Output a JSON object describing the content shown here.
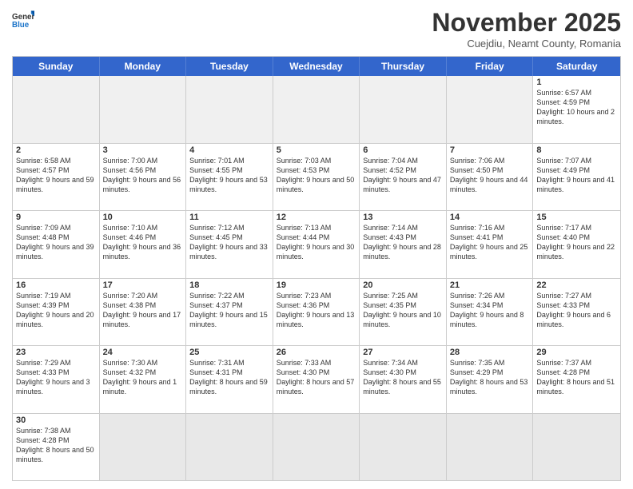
{
  "logo": {
    "line1": "General",
    "line2": "Blue"
  },
  "title": "November 2025",
  "subtitle": "Cuejdiu, Neamt County, Romania",
  "header_days": [
    "Sunday",
    "Monday",
    "Tuesday",
    "Wednesday",
    "Thursday",
    "Friday",
    "Saturday"
  ],
  "weeks": [
    [
      {
        "day": "",
        "info": "",
        "empty": true
      },
      {
        "day": "",
        "info": "",
        "empty": true
      },
      {
        "day": "",
        "info": "",
        "empty": true
      },
      {
        "day": "",
        "info": "",
        "empty": true
      },
      {
        "day": "",
        "info": "",
        "empty": true
      },
      {
        "day": "",
        "info": "",
        "empty": true
      },
      {
        "day": "1",
        "info": "Sunrise: 6:57 AM\nSunset: 4:59 PM\nDaylight: 10 hours and 2 minutes."
      }
    ],
    [
      {
        "day": "2",
        "info": "Sunrise: 6:58 AM\nSunset: 4:57 PM\nDaylight: 9 hours and 59 minutes."
      },
      {
        "day": "3",
        "info": "Sunrise: 7:00 AM\nSunset: 4:56 PM\nDaylight: 9 hours and 56 minutes."
      },
      {
        "day": "4",
        "info": "Sunrise: 7:01 AM\nSunset: 4:55 PM\nDaylight: 9 hours and 53 minutes."
      },
      {
        "day": "5",
        "info": "Sunrise: 7:03 AM\nSunset: 4:53 PM\nDaylight: 9 hours and 50 minutes."
      },
      {
        "day": "6",
        "info": "Sunrise: 7:04 AM\nSunset: 4:52 PM\nDaylight: 9 hours and 47 minutes."
      },
      {
        "day": "7",
        "info": "Sunrise: 7:06 AM\nSunset: 4:50 PM\nDaylight: 9 hours and 44 minutes."
      },
      {
        "day": "8",
        "info": "Sunrise: 7:07 AM\nSunset: 4:49 PM\nDaylight: 9 hours and 41 minutes."
      }
    ],
    [
      {
        "day": "9",
        "info": "Sunrise: 7:09 AM\nSunset: 4:48 PM\nDaylight: 9 hours and 39 minutes."
      },
      {
        "day": "10",
        "info": "Sunrise: 7:10 AM\nSunset: 4:46 PM\nDaylight: 9 hours and 36 minutes."
      },
      {
        "day": "11",
        "info": "Sunrise: 7:12 AM\nSunset: 4:45 PM\nDaylight: 9 hours and 33 minutes."
      },
      {
        "day": "12",
        "info": "Sunrise: 7:13 AM\nSunset: 4:44 PM\nDaylight: 9 hours and 30 minutes."
      },
      {
        "day": "13",
        "info": "Sunrise: 7:14 AM\nSunset: 4:43 PM\nDaylight: 9 hours and 28 minutes."
      },
      {
        "day": "14",
        "info": "Sunrise: 7:16 AM\nSunset: 4:41 PM\nDaylight: 9 hours and 25 minutes."
      },
      {
        "day": "15",
        "info": "Sunrise: 7:17 AM\nSunset: 4:40 PM\nDaylight: 9 hours and 22 minutes."
      }
    ],
    [
      {
        "day": "16",
        "info": "Sunrise: 7:19 AM\nSunset: 4:39 PM\nDaylight: 9 hours and 20 minutes."
      },
      {
        "day": "17",
        "info": "Sunrise: 7:20 AM\nSunset: 4:38 PM\nDaylight: 9 hours and 17 minutes."
      },
      {
        "day": "18",
        "info": "Sunrise: 7:22 AM\nSunset: 4:37 PM\nDaylight: 9 hours and 15 minutes."
      },
      {
        "day": "19",
        "info": "Sunrise: 7:23 AM\nSunset: 4:36 PM\nDaylight: 9 hours and 13 minutes."
      },
      {
        "day": "20",
        "info": "Sunrise: 7:25 AM\nSunset: 4:35 PM\nDaylight: 9 hours and 10 minutes."
      },
      {
        "day": "21",
        "info": "Sunrise: 7:26 AM\nSunset: 4:34 PM\nDaylight: 9 hours and 8 minutes."
      },
      {
        "day": "22",
        "info": "Sunrise: 7:27 AM\nSunset: 4:33 PM\nDaylight: 9 hours and 6 minutes."
      }
    ],
    [
      {
        "day": "23",
        "info": "Sunrise: 7:29 AM\nSunset: 4:33 PM\nDaylight: 9 hours and 3 minutes."
      },
      {
        "day": "24",
        "info": "Sunrise: 7:30 AM\nSunset: 4:32 PM\nDaylight: 9 hours and 1 minute."
      },
      {
        "day": "25",
        "info": "Sunrise: 7:31 AM\nSunset: 4:31 PM\nDaylight: 8 hours and 59 minutes."
      },
      {
        "day": "26",
        "info": "Sunrise: 7:33 AM\nSunset: 4:30 PM\nDaylight: 8 hours and 57 minutes."
      },
      {
        "day": "27",
        "info": "Sunrise: 7:34 AM\nSunset: 4:30 PM\nDaylight: 8 hours and 55 minutes."
      },
      {
        "day": "28",
        "info": "Sunrise: 7:35 AM\nSunset: 4:29 PM\nDaylight: 8 hours and 53 minutes."
      },
      {
        "day": "29",
        "info": "Sunrise: 7:37 AM\nSunset: 4:28 PM\nDaylight: 8 hours and 51 minutes."
      }
    ],
    [
      {
        "day": "30",
        "info": "Sunrise: 7:38 AM\nSunset: 4:28 PM\nDaylight: 8 hours and 50 minutes."
      },
      {
        "day": "",
        "info": "",
        "empty": true
      },
      {
        "day": "",
        "info": "",
        "empty": true
      },
      {
        "day": "",
        "info": "",
        "empty": true
      },
      {
        "day": "",
        "info": "",
        "empty": true
      },
      {
        "day": "",
        "info": "",
        "empty": true
      },
      {
        "day": "",
        "info": "",
        "empty": true
      }
    ]
  ]
}
